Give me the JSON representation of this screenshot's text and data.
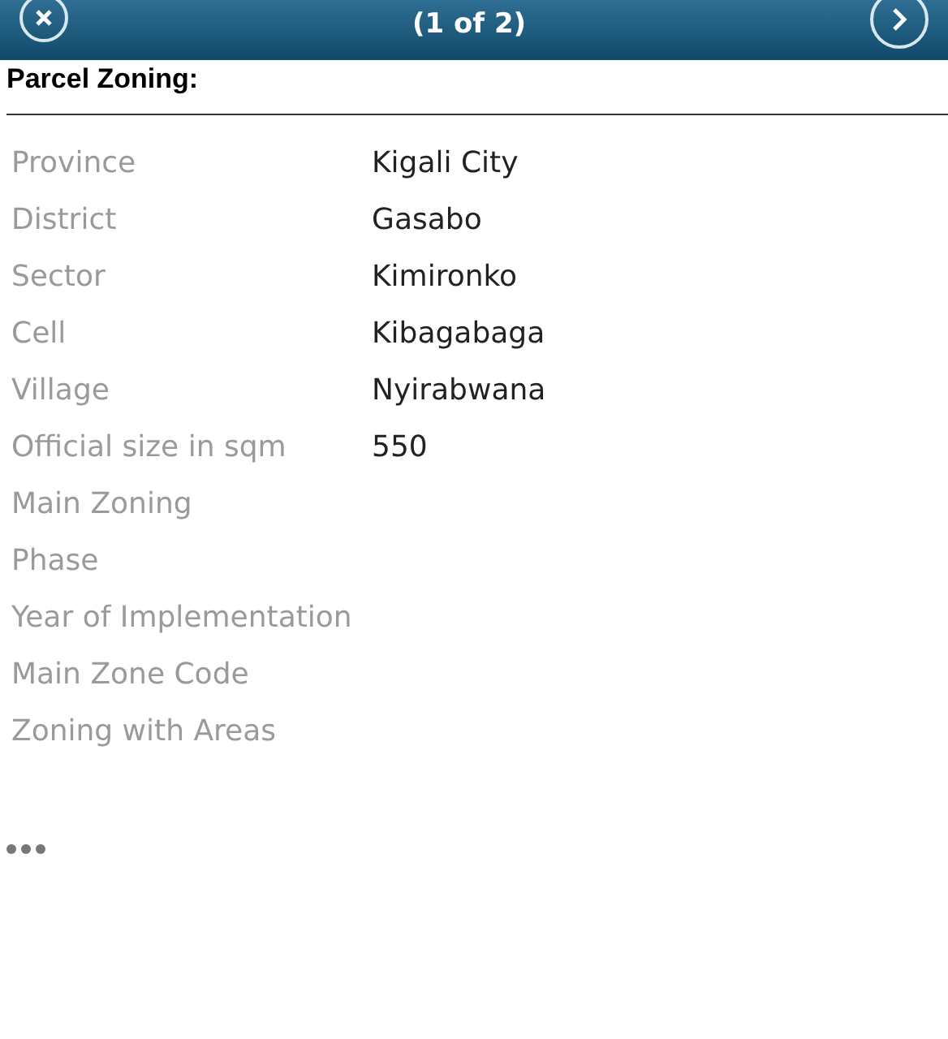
{
  "header": {
    "title": "(1 of 2)"
  },
  "section": {
    "title": "Parcel Zoning:"
  },
  "fields": [
    {
      "label": "Province",
      "value": "Kigali City"
    },
    {
      "label": "District",
      "value": "Gasabo"
    },
    {
      "label": "Sector",
      "value": "Kimironko"
    },
    {
      "label": "Cell",
      "value": "Kibagabaga"
    },
    {
      "label": "Village",
      "value": "Nyirabwana"
    },
    {
      "label": "Official size in sqm",
      "value": "550"
    },
    {
      "label": "Main Zoning"
    },
    {
      "label": "Phase"
    },
    {
      "label": "Year of Implementation"
    },
    {
      "label": "Main Zone Code"
    },
    {
      "label": "Zoning with Areas"
    }
  ]
}
